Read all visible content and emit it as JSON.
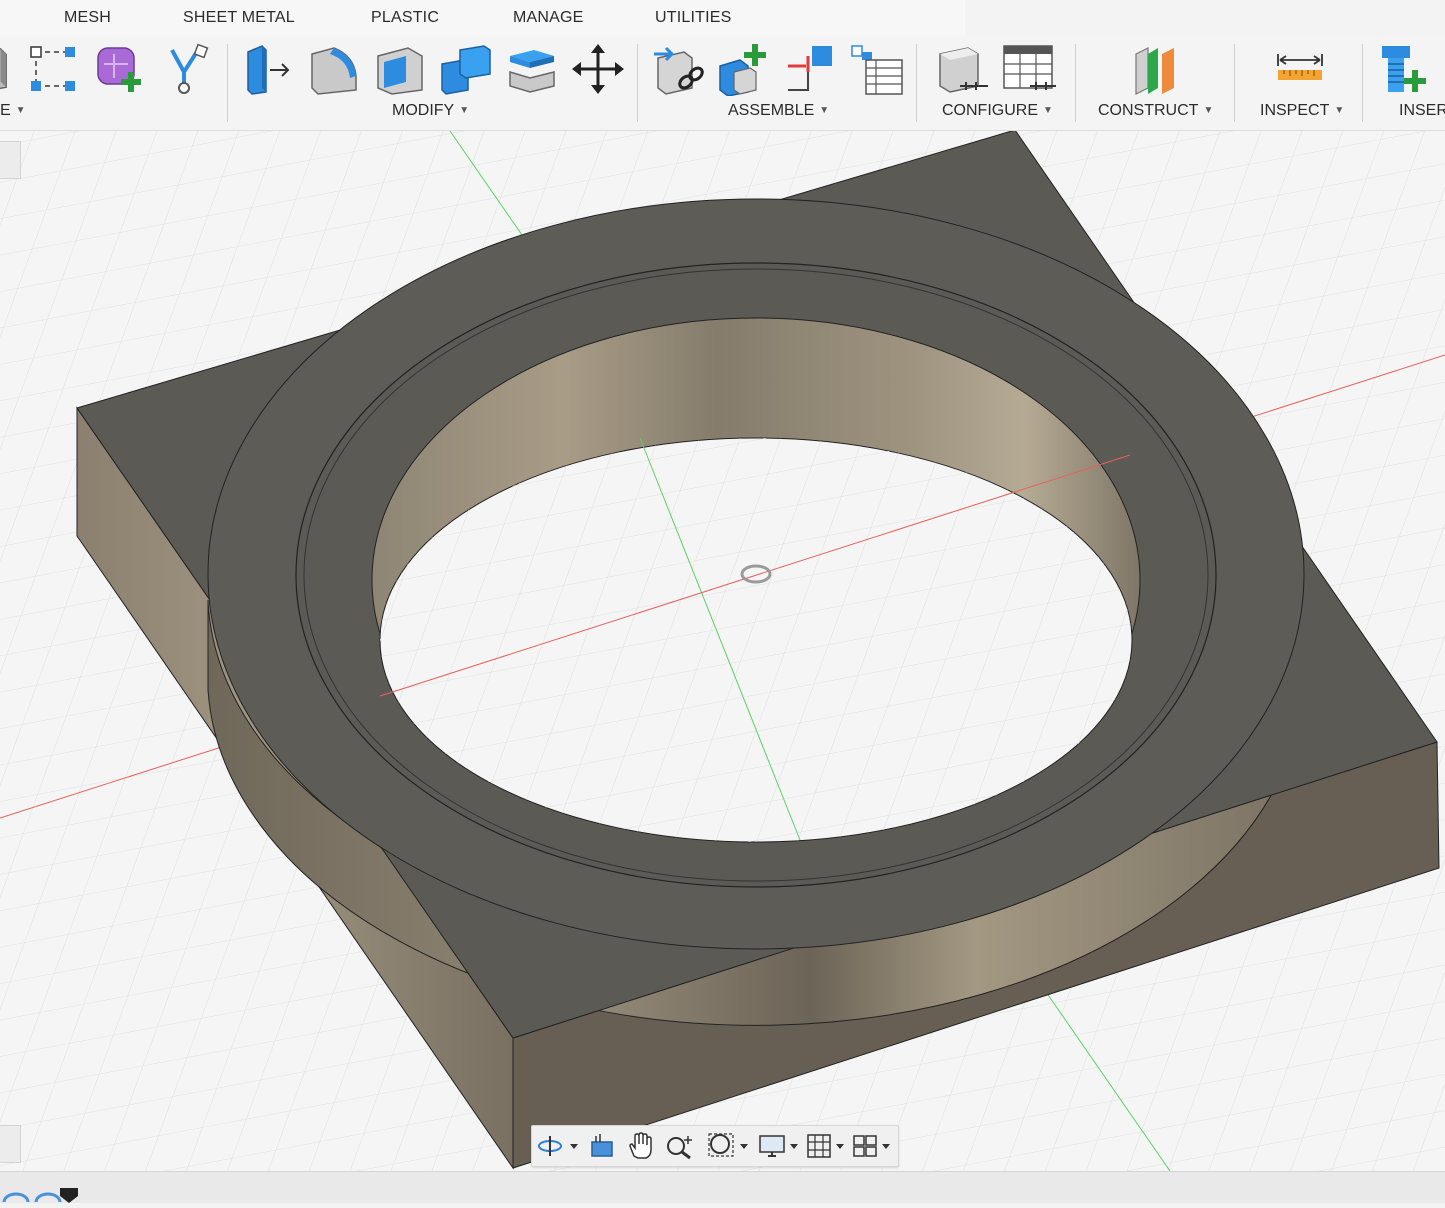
{
  "tabs": [
    "MESH",
    "SHEET METAL",
    "PLASTIC",
    "MANAGE",
    "UTILITIES"
  ],
  "groups": {
    "create_partial": "E",
    "modify": "MODIFY",
    "assemble": "ASSEMBLE",
    "configure": "CONFIGURE",
    "construct": "CONSTRUCT",
    "inspect": "INSPECT",
    "insert": "INSER"
  },
  "icons": {
    "create": [
      "box-icon",
      "sketch-points-icon",
      "form-add-icon",
      "slingshot-icon"
    ],
    "modify": [
      "press-pull-icon",
      "fillet-icon",
      "shell-icon",
      "combine-icon",
      "split-body-icon",
      "move-icon"
    ],
    "assemble": [
      "new-component-link-icon",
      "new-component-icon",
      "joint-icon",
      "bill-of-materials-icon"
    ],
    "configure": [
      "configure-feature-icon",
      "configure-table-icon"
    ],
    "construct": [
      "offset-plane-icon"
    ],
    "inspect": [
      "measure-icon"
    ],
    "insert": [
      "insert-mcmaster-icon"
    ]
  },
  "navbar": [
    "orbit-icon",
    "look-at-icon",
    "pan-icon",
    "zoom-icon",
    "fit-icon",
    "display-settings-icon",
    "grid-icon",
    "viewports-icon"
  ],
  "colors": {
    "body_top": "#5b5a55",
    "body_side": "#7b7264",
    "x_axis": "#e56060",
    "y_axis": "#5bd16a",
    "grid": "#dcdcdc"
  }
}
